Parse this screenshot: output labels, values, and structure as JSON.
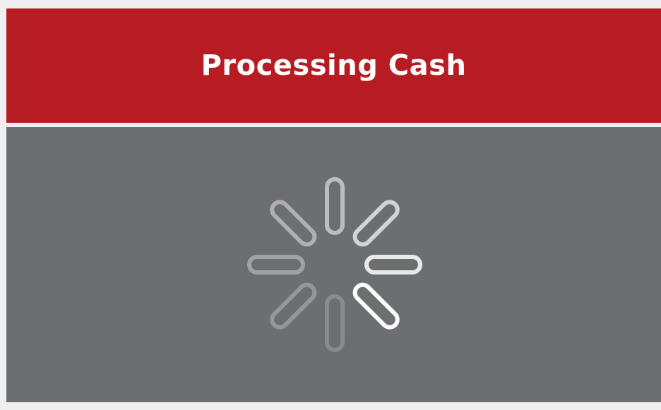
{
  "dialog": {
    "title": "Processing Cash"
  },
  "spinner": {
    "icon": "loading-spinner-icon",
    "color": "#ffffff"
  },
  "colors": {
    "header": "#b71c22",
    "panel": "#6d6e72",
    "background": "#efefef"
  }
}
